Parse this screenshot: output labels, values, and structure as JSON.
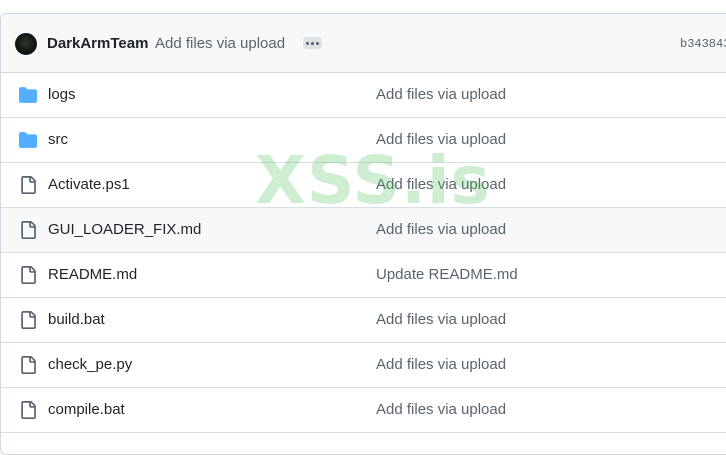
{
  "commit_header": {
    "author": "DarkArmTeam",
    "message": "Add files via upload",
    "sha": "b343843",
    "more_icon": "kebab-horizontal-icon"
  },
  "files": [
    {
      "name": "logs",
      "type": "folder",
      "icon": "folder-icon",
      "message": "Add files via upload"
    },
    {
      "name": "src",
      "type": "folder",
      "icon": "folder-icon",
      "message": "Add files via upload"
    },
    {
      "name": "Activate.ps1",
      "type": "file",
      "icon": "file-icon",
      "message": "Add files via upload"
    },
    {
      "name": "GUI_LOADER_FIX.md",
      "type": "file",
      "icon": "file-icon",
      "message": "Add files via upload"
    },
    {
      "name": "README.md",
      "type": "file",
      "icon": "file-icon",
      "message": "Update README.md"
    },
    {
      "name": "build.bat",
      "type": "file",
      "icon": "file-icon",
      "message": "Add files via upload"
    },
    {
      "name": "check_pe.py",
      "type": "file",
      "icon": "file-icon",
      "message": "Add files via upload"
    },
    {
      "name": "compile.bat",
      "type": "file",
      "icon": "file-icon",
      "message": "Add files via upload"
    }
  ],
  "watermark": "XSS.is",
  "colors": {
    "folder": "#54aeff",
    "file_icon": "#59636e",
    "header_bg": "#f6f8fa",
    "border": "#d0d7de",
    "watermark": "#8fd896"
  }
}
